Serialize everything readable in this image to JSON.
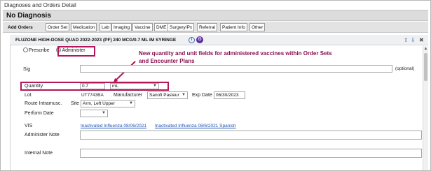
{
  "window": {
    "title": "Diagnoses and Orders Detail"
  },
  "diagnosis": {
    "label": "No Diagnosis"
  },
  "tabs": [
    {
      "label": "Add Orders"
    },
    {
      "label": "Order Set"
    },
    {
      "label": "Medication"
    },
    {
      "label": "Lab"
    },
    {
      "label": "Imaging"
    },
    {
      "label": "Vaccine"
    },
    {
      "label": "DME"
    },
    {
      "label": "Surgery/Px"
    },
    {
      "label": "Referral"
    },
    {
      "label": "Patient Info"
    },
    {
      "label": "Other"
    }
  ],
  "order": {
    "title": "FLUZONE HIGH-DOSE QUAD 2022-2023 (PF) 240 MCG/0.7 ML IM SYRINGE",
    "info_icon": "info-icon",
    "gear_icon": "gear-icon",
    "up_icon": "arrow-up-icon",
    "down_icon": "arrow-down-icon",
    "close_icon": "close-icon"
  },
  "mode": {
    "prescribe_label": "Prescribe",
    "administer_label": "Administer",
    "selected": "Administer"
  },
  "callout": {
    "text": "New quantity and unit fields for administered vaccines within Order Sets and Encounter Plans",
    "color": "#8a1050"
  },
  "form": {
    "sig_label": "Sig",
    "sig_value": "",
    "sig_optional": "(optional)",
    "quantity_label": "Quantity",
    "quantity_value": "0.7",
    "unit_value": "mL",
    "lot_label": "Lot",
    "lot_value": "UT7743BA",
    "manufacturer_label": "Manufacturer",
    "manufacturer_value": "Sanofi Pasteur",
    "exp_label": "Exp Date",
    "exp_value": "06/30/2023",
    "route_label": "Route Intramusc.",
    "site_label": "Site",
    "site_value": "Arm, Left Upper",
    "perform_label": "Perform Date",
    "perform_value": "",
    "vis_label": "VIS",
    "vis_links": [
      "Inactivated Influenza 08/06/2021",
      "Inactivated Influenza 08/6/2021 Spanish"
    ],
    "admin_note_label": "Administer Note",
    "internal_note_label": "Internal Note"
  },
  "colors": {
    "highlight": "#b3165a",
    "link": "#1f55b2",
    "header_bg": "#dcdcdc"
  }
}
